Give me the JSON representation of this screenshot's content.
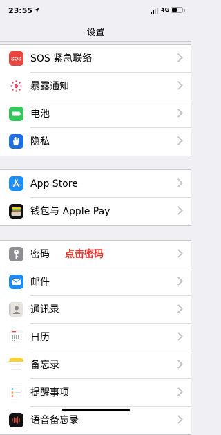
{
  "status_bar": {
    "time": "23:55",
    "network": "4G"
  },
  "nav": {
    "title": "设置"
  },
  "groups": [
    {
      "rows": [
        {
          "label": "SOS 紧急联络",
          "icon": "sos-icon",
          "icon_text": "SOS",
          "color": "#e8453c"
        },
        {
          "label": "暴露通知",
          "icon": "exposure-notification-icon",
          "color": "#ffffff"
        },
        {
          "label": "电池",
          "icon": "battery-icon",
          "color": "#34c759"
        },
        {
          "label": "隐私",
          "icon": "hand-icon",
          "color": "#1f6fe0"
        }
      ]
    },
    {
      "rows": [
        {
          "label": "App Store",
          "icon": "app-store-icon",
          "color": "#1c8ef9"
        },
        {
          "label": "钱包与 Apple Pay",
          "icon": "wallet-icon",
          "color": "#111111"
        }
      ]
    },
    {
      "rows": [
        {
          "label": "密码",
          "icon": "key-icon",
          "color": "#8e8e93",
          "annotation": "点击密码",
          "annotation_color": "#e8322b"
        },
        {
          "label": "邮件",
          "icon": "mail-icon",
          "color": "#1a8cf5"
        },
        {
          "label": "通讯录",
          "icon": "contacts-icon",
          "color": "#e6e3df"
        },
        {
          "label": "日历",
          "icon": "calendar-icon",
          "color": "#ffffff"
        },
        {
          "label": "备忘录",
          "icon": "notes-icon",
          "color": "#fbd037"
        },
        {
          "label": "提醒事项",
          "icon": "reminders-icon",
          "color": "#ffffff"
        },
        {
          "label": "语音备忘录",
          "icon": "voice-memos-icon",
          "color": "#111111"
        }
      ]
    }
  ]
}
